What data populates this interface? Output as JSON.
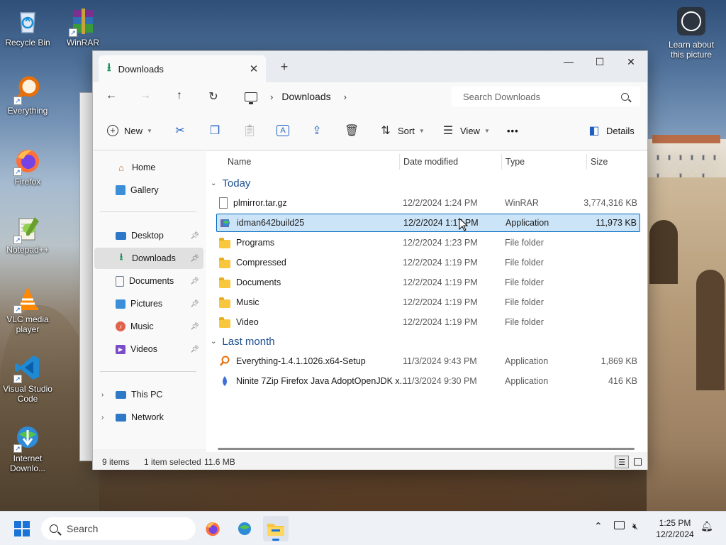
{
  "desktop": {
    "icons": [
      {
        "label": "Recycle Bin"
      },
      {
        "label": "WinRAR"
      },
      {
        "label": "Everything"
      },
      {
        "label": "Firefox"
      },
      {
        "label": "Notepad++"
      },
      {
        "label": "VLC media player"
      },
      {
        "label": "Visual Studio Code"
      },
      {
        "label": "Internet Downlo..."
      }
    ],
    "learn_label": "Learn about this picture"
  },
  "window": {
    "tab_title": "Downloads",
    "address": {
      "current": "Downloads",
      "search_placeholder": "Search Downloads"
    },
    "toolbar": {
      "new_label": "New",
      "sort_label": "Sort",
      "view_label": "View",
      "more_label": "•••",
      "details_label": "Details"
    },
    "sidebar": {
      "home": "Home",
      "gallery": "Gallery",
      "quick": [
        {
          "label": "Desktop",
          "icon": "desktop-icon"
        },
        {
          "label": "Downloads",
          "icon": "download-icon"
        },
        {
          "label": "Documents",
          "icon": "documents-icon"
        },
        {
          "label": "Pictures",
          "icon": "pictures-icon"
        },
        {
          "label": "Music",
          "icon": "music-icon"
        },
        {
          "label": "Videos",
          "icon": "videos-icon"
        }
      ],
      "this_pc": "This PC",
      "network": "Network"
    },
    "columns": {
      "name": "Name",
      "date": "Date modified",
      "type": "Type",
      "size": "Size"
    },
    "groups": [
      {
        "label": "Today",
        "files": [
          {
            "name": "plmirror.tar.gz",
            "date": "12/2/2024 1:24 PM",
            "type": "WinRAR",
            "size": "3,774,316 KB",
            "icon": "archive-file-icon"
          },
          {
            "name": "idman642build25",
            "date": "12/2/2024 1:17 PM",
            "type": "Application",
            "size": "11,973 KB",
            "icon": "idm-installer-icon",
            "selected": true
          },
          {
            "name": "Programs",
            "date": "12/2/2024 1:23 PM",
            "type": "File folder",
            "size": "",
            "icon": "folder-icon"
          },
          {
            "name": "Compressed",
            "date": "12/2/2024 1:19 PM",
            "type": "File folder",
            "size": "",
            "icon": "folder-icon"
          },
          {
            "name": "Documents",
            "date": "12/2/2024 1:19 PM",
            "type": "File folder",
            "size": "",
            "icon": "folder-icon"
          },
          {
            "name": "Music",
            "date": "12/2/2024 1:19 PM",
            "type": "File folder",
            "size": "",
            "icon": "folder-icon"
          },
          {
            "name": "Video",
            "date": "12/2/2024 1:19 PM",
            "type": "File folder",
            "size": "",
            "icon": "folder-icon"
          }
        ]
      },
      {
        "label": "Last month",
        "files": [
          {
            "name": "Everything-1.4.1.1026.x64-Setup",
            "date": "11/3/2024 9:43 PM",
            "type": "Application",
            "size": "1,869 KB",
            "icon": "everything-setup-icon"
          },
          {
            "name": "Ninite 7Zip Firefox Java AdoptOpenJDK x...",
            "date": "11/3/2024 9:30 PM",
            "type": "Application",
            "size": "416 KB",
            "icon": "ninite-icon"
          }
        ]
      }
    ],
    "status": {
      "items": "9 items",
      "selection": "1 item selected",
      "size": "11.6 MB"
    }
  },
  "taskbar": {
    "search_placeholder": "Search",
    "time": "1:25 PM",
    "date": "12/2/2024"
  },
  "colors": {
    "accent": "#0067c0",
    "selection_bg": "#cce4f7",
    "group_header": "#1c4f8f",
    "folder": "#f8c73e"
  }
}
